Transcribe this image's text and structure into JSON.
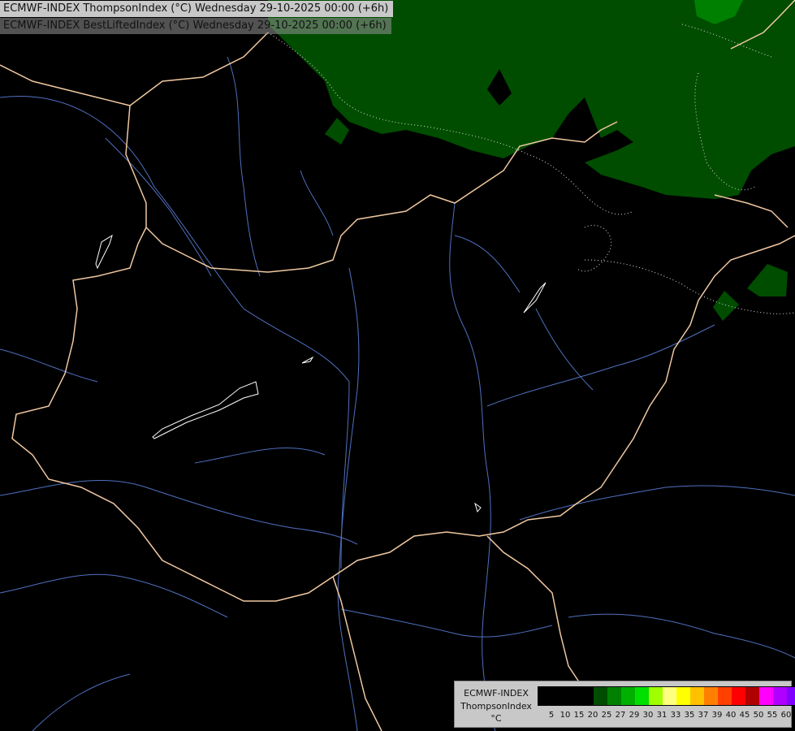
{
  "header": {
    "line1": "ECMWF-INDEX ThompsonIndex (°C) Wednesday 29-10-2025 00:00 (+6h)",
    "line2": "ECMWF-INDEX BestLiftedIndex (°C) Wednesday 29-10-2025 00:00 (+6h)"
  },
  "legend": {
    "model": "ECMWF-INDEX",
    "parameter": "ThompsonIndex",
    "unit": "°C",
    "colors": [
      "#000000",
      "#000000",
      "#000000",
      "#000000",
      "#004d00",
      "#008000",
      "#00b000",
      "#00e000",
      "#a0ff00",
      "#ffff80",
      "#ffff00",
      "#ffc000",
      "#ff8000",
      "#ff4000",
      "#ff0000",
      "#b00000",
      "#ff00ff",
      "#b000ff",
      "#7f00ff",
      "#4000ff",
      "#0000ff"
    ],
    "ticks": [
      "5",
      "10",
      "15",
      "20",
      "25",
      "27",
      "29",
      "30",
      "31",
      "33",
      "35",
      "37",
      "39",
      "40",
      "45",
      "50",
      "55",
      "60"
    ]
  },
  "colors": {
    "border": "#f0c8a0",
    "river": "#5070c0",
    "field_dark": "#004d00",
    "field_mid": "#008000",
    "field_light": "#00b000"
  }
}
